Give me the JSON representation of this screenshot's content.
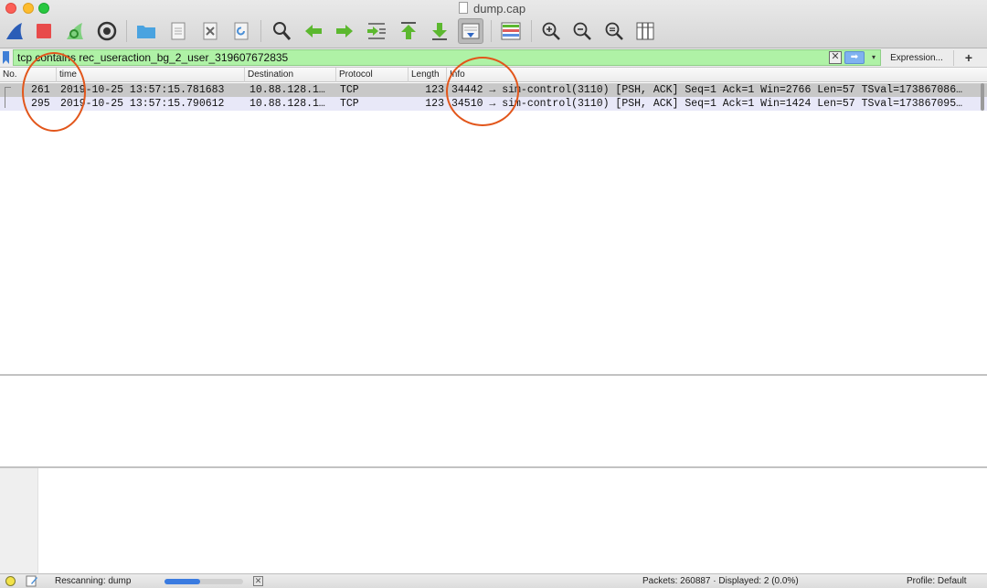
{
  "window": {
    "title": "dump.cap"
  },
  "toolbar": {
    "buttons": [
      {
        "id": "start-capture",
        "icon": "shark-fin-icon",
        "color": "#2b5db7"
      },
      {
        "id": "stop-capture",
        "icon": "stop-icon",
        "color": "#e84b4b"
      },
      {
        "id": "restart-capture",
        "icon": "restart-fin-icon",
        "color": "#43b443"
      },
      {
        "id": "capture-options",
        "icon": "gear-icon",
        "color": "#333333"
      },
      {
        "id": "open-file",
        "icon": "folder-icon",
        "color": "#4aa3e0"
      },
      {
        "id": "save-file",
        "icon": "file-icon",
        "color": "#8a8a8a"
      },
      {
        "id": "close-file",
        "icon": "close-file-icon",
        "color": "#8a8a8a"
      },
      {
        "id": "reload-file",
        "icon": "reload-icon",
        "color": "#8a8a8a"
      },
      {
        "id": "find-packet",
        "icon": "magnifier-icon",
        "color": "#333333"
      },
      {
        "id": "go-back",
        "icon": "arrow-left-icon",
        "color": "#5cb82f"
      },
      {
        "id": "go-forward",
        "icon": "arrow-right-icon",
        "color": "#5cb82f"
      },
      {
        "id": "go-to-packet",
        "icon": "go-to-packet-icon",
        "color": "#5cb82f"
      },
      {
        "id": "first-packet",
        "icon": "arrow-up-bar-icon",
        "color": "#5cb82f"
      },
      {
        "id": "last-packet",
        "icon": "arrow-down-bar-icon",
        "color": "#5cb82f"
      },
      {
        "id": "autoscroll",
        "icon": "autoscroll-icon",
        "color": "#2f66c2"
      },
      {
        "id": "colorize",
        "icon": "colorize-lines-icon",
        "color": "#5cb82f"
      },
      {
        "id": "zoom-in",
        "icon": "zoom-in-icon",
        "color": "#333333"
      },
      {
        "id": "zoom-out",
        "icon": "zoom-out-icon",
        "color": "#333333"
      },
      {
        "id": "zoom-reset",
        "icon": "zoom-reset-icon",
        "color": "#333333"
      },
      {
        "id": "resize-columns",
        "icon": "resize-columns-icon",
        "color": "#333333"
      }
    ]
  },
  "filter": {
    "value": "tcp contains rec_useraction_bg_2_user_319607672835",
    "clear_symbol": "✕",
    "apply_symbol": "➡",
    "dropdown_symbol": "▾",
    "expression_label": "Expression...",
    "add_label": "+",
    "valid_color": "#aff2a6"
  },
  "packet_list": {
    "columns": [
      "No.",
      "time",
      "Destination",
      "Protocol",
      "Length",
      "Info"
    ],
    "rows": [
      {
        "no": "261",
        "time": "2019-10-25 13:57:15.781683",
        "destination": "10.88.128.1…",
        "protocol": "TCP",
        "length": "123",
        "info": "34442 → sim-control(3110) [PSH, ACK] Seq=1 Ack=1 Win=2766 Len=57 TSval=173867086…",
        "selected": true
      },
      {
        "no": "295",
        "time": "2019-10-25 13:57:15.790612",
        "destination": "10.88.128.1…",
        "protocol": "TCP",
        "length": "123",
        "info": "34510 → sim-control(3110) [PSH, ACK] Seq=1 Ack=1 Win=1424 Len=57 TSval=173867095…",
        "selected": false
      }
    ]
  },
  "annotations": {
    "circle_color": "#e2561b"
  },
  "status": {
    "text": "Rescanning: dump",
    "progress_fraction": 0.45,
    "cancel_symbol": "✕",
    "packets": "Packets: 260887 · Displayed: 2 (0.0%)",
    "profile": "Profile: Default"
  }
}
